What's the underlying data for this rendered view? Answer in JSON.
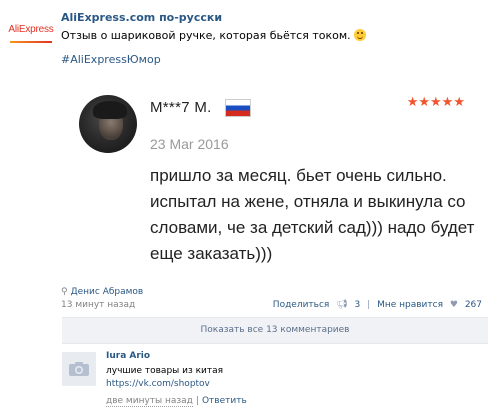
{
  "post": {
    "group_logo": "AliExpress",
    "group_name": "AliExpress.com по-русски",
    "text": "Отзыв о шариковой ручке, которая бьётся током.",
    "emoji": "smiling-face-icon",
    "hashtag": "#AliExpressЮмор"
  },
  "review": {
    "reviewer_name": "M***7 M.",
    "flag": "russia-flag-icon",
    "stars": "★★★★★",
    "rating": 5,
    "date": "23 Mar 2016",
    "body": "пришло за месяц. бьет очень сильно. испытал на жене, отняла и выкинула со словами, че за детский сад))) надо будет еще заказать)))"
  },
  "author": {
    "name": "Денис Абрамов",
    "time": "13 минут назад"
  },
  "actions": {
    "share_label": "Поделиться",
    "share_count": "3",
    "like_label": "Мне нравится",
    "like_count": "267"
  },
  "comments": {
    "show_all_label": "Показать все 13 комментариев",
    "first": {
      "author": "Iura Ario",
      "text": "лучшие товары из китая",
      "link": "https://vk.com/shoptov",
      "time": "две минуты назад",
      "separator": "|",
      "reply_label": "Ответить"
    }
  },
  "colors": {
    "link": "#2a5885",
    "stars": "#f2542d",
    "logo_red": "#e43225"
  }
}
